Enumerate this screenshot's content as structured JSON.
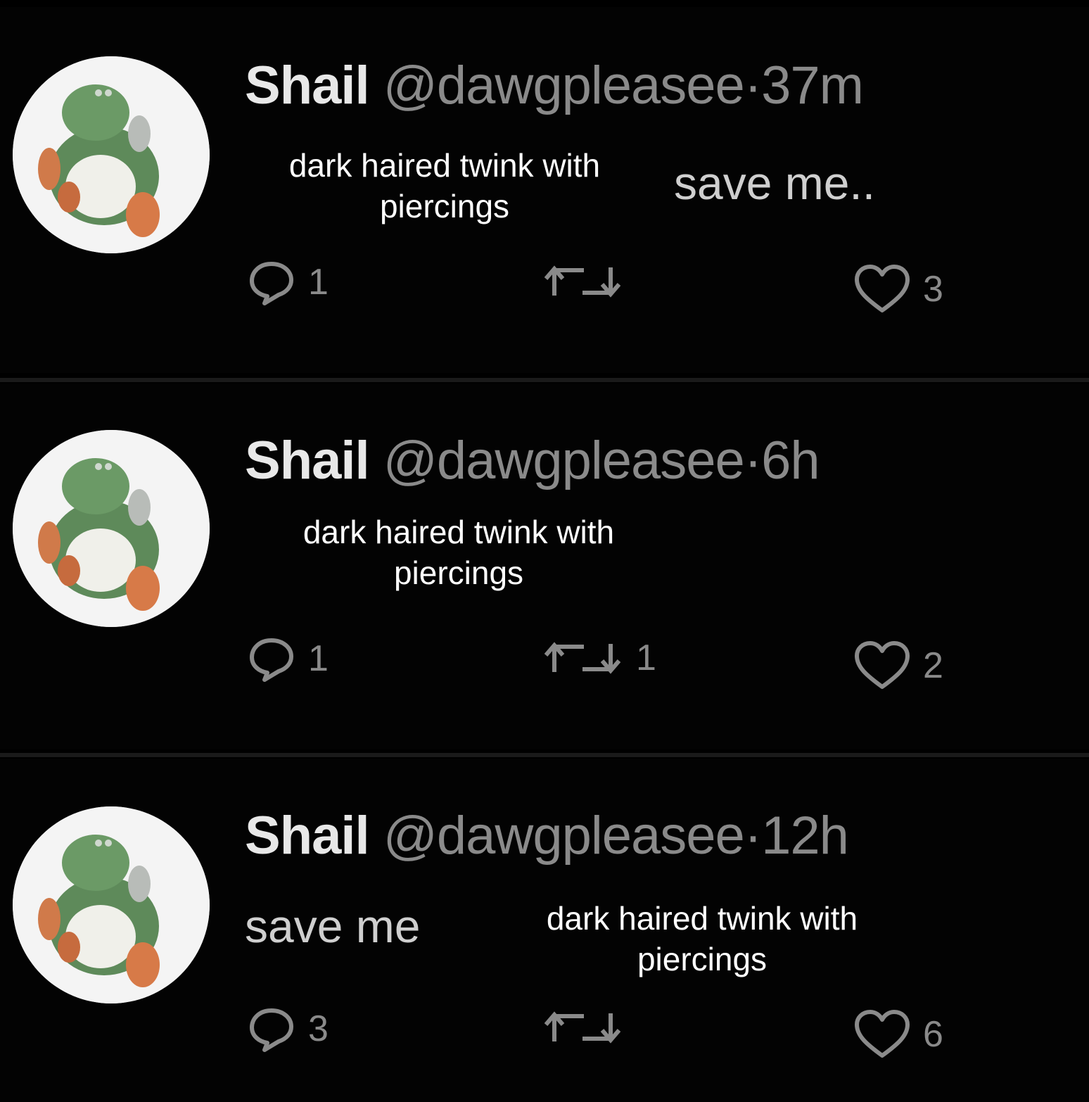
{
  "tweets": [
    {
      "name": "Shail",
      "handle": "@dawgpleasee",
      "separator": "·",
      "time": "37m",
      "body": "save me..",
      "caption": "dark haired twink with piercings",
      "replies": "1",
      "retweets": "",
      "likes": "3"
    },
    {
      "name": "Shail",
      "handle": "@dawgpleasee",
      "separator": "·",
      "time": "6h",
      "body": "",
      "caption": "dark haired twink with piercings",
      "replies": "1",
      "retweets": "1",
      "likes": "2"
    },
    {
      "name": "Shail",
      "handle": "@dawgpleasee",
      "separator": "·",
      "time": "12h",
      "body": "save me",
      "caption": "dark haired twink with piercings",
      "replies": "3",
      "retweets": "",
      "likes": "6"
    }
  ],
  "icons": {
    "avatar": "green-dinosaur-avatar",
    "reply": "reply-icon",
    "retweet": "retweet-icon",
    "like": "heart-icon"
  },
  "colors": {
    "background": "#000000",
    "name": "#e8e8e8",
    "muted": "#8a8a8a",
    "caption": "#ffffff"
  }
}
